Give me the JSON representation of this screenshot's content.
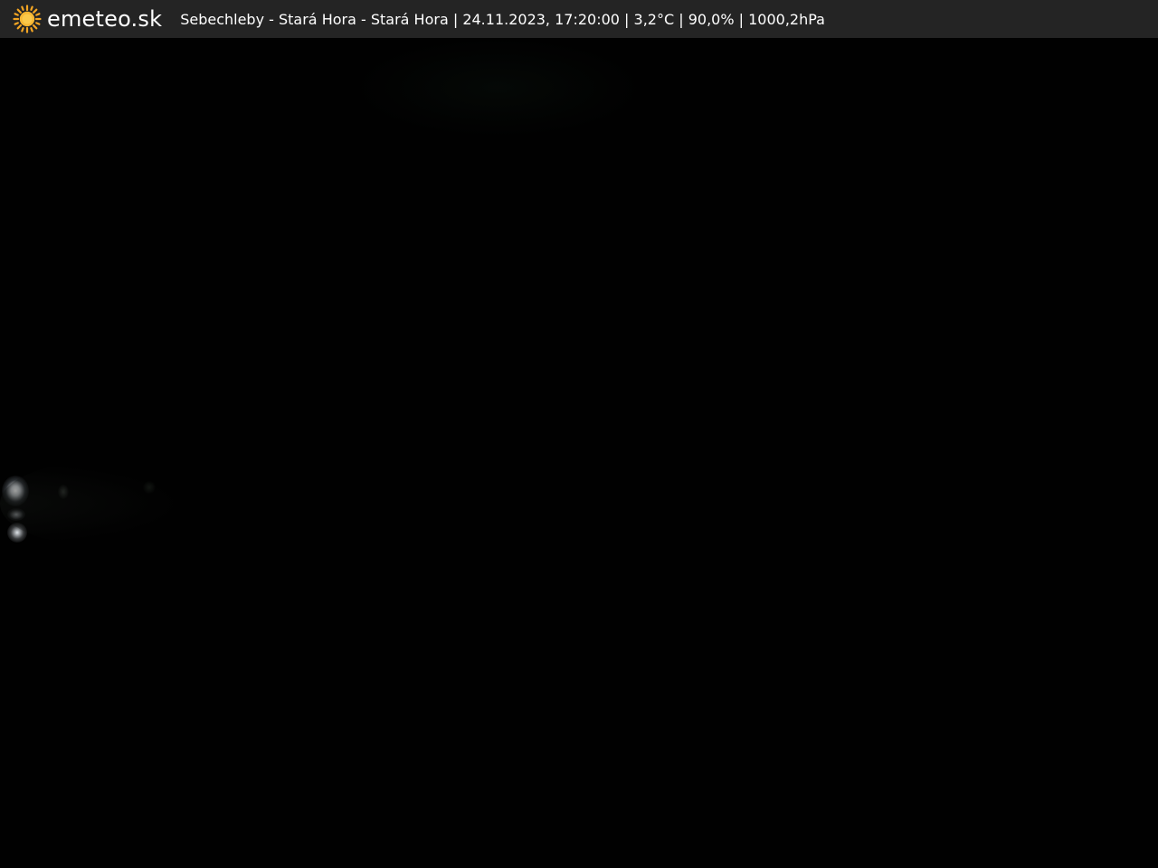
{
  "brand": {
    "name": "emeteo.sk",
    "logo_icon": "sun-icon",
    "logo_color": "#f5a623"
  },
  "caption": {
    "location": "Sebechleby - Stará Hora - Stará Hora",
    "datetime": "24.11.2023, 17:20:00",
    "temperature": "3,2°C",
    "humidity": "90,0%",
    "pressure": "1000,2hPa",
    "separator": " | "
  },
  "colors": {
    "topbar_bg": "#242424",
    "scene_bg": "#010101",
    "text": "#ffffff"
  }
}
